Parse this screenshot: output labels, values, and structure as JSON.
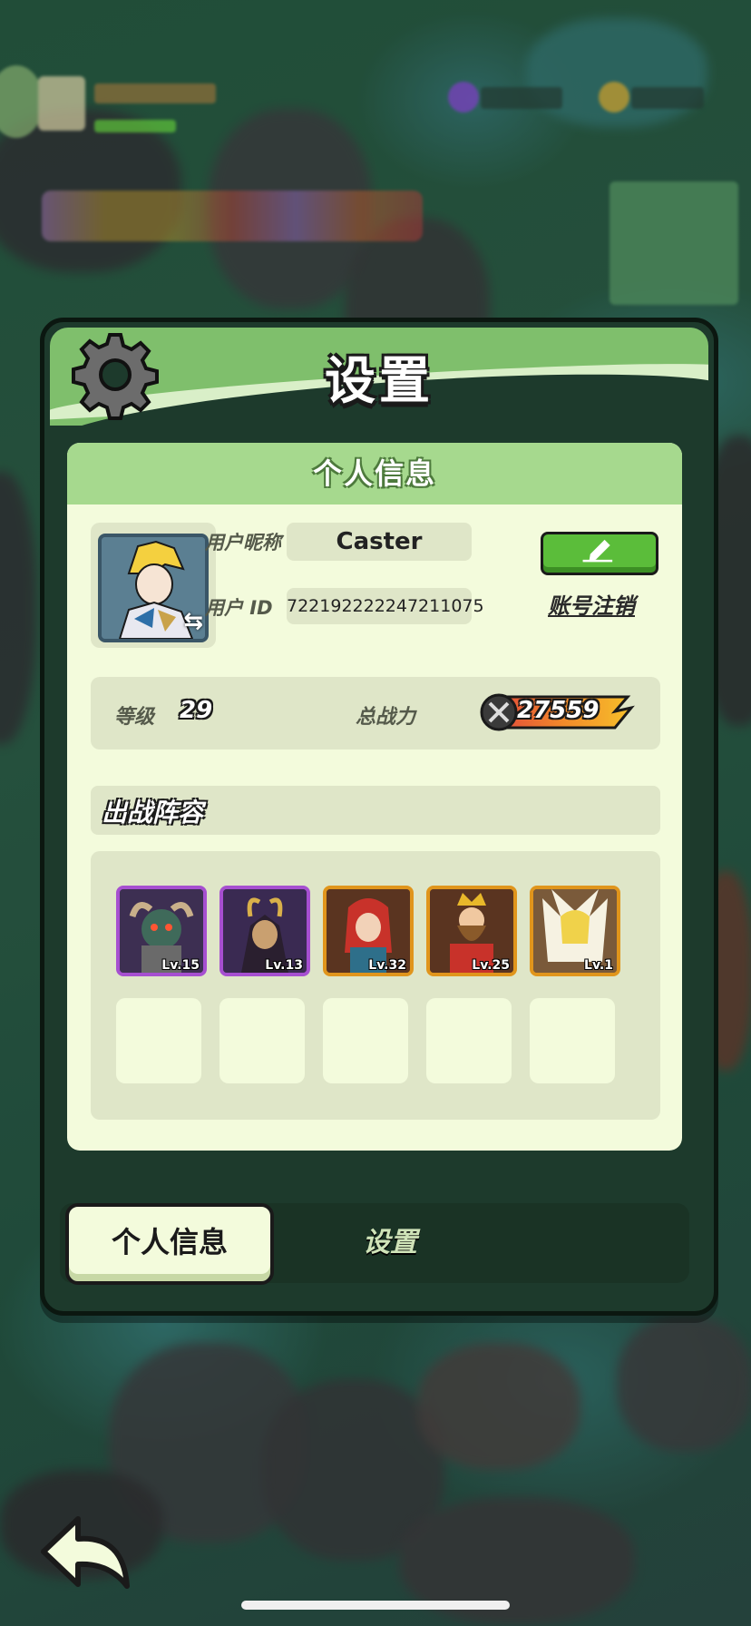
{
  "dialog": {
    "title": "设置",
    "section_title": "个人信息",
    "nickname_label": "用户昵称",
    "nickname_value": "Caster",
    "user_id_label": "用户 ID",
    "user_id_value": "722192222247211075",
    "cancel_account_label": "账号注销",
    "level_label": "等级",
    "level_value": "29",
    "power_label": "总战力",
    "power_value": "27559",
    "lineup_title": "出战阵容",
    "heroes": [
      {
        "level": "Lv.15",
        "frame": "#a64fd0"
      },
      {
        "level": "Lv.13",
        "frame": "#a64fd0"
      },
      {
        "level": "Lv.32",
        "frame": "#e0951c"
      },
      {
        "level": "Lv.25",
        "frame": "#e0951c"
      },
      {
        "level": "Lv.1",
        "frame": "#e0951c"
      }
    ]
  },
  "tabs": {
    "active": "个人信息",
    "inactive": "设置"
  },
  "colors": {
    "header_green": "#7fbf6c",
    "card_bg": "#f3fbdc",
    "edit_button": "#5bbd3a"
  }
}
